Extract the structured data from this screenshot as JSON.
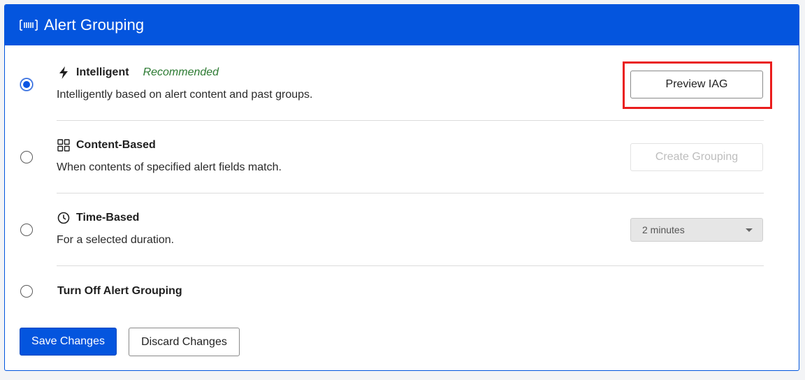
{
  "header": {
    "title": "Alert Grouping",
    "icon": "barcode-icon"
  },
  "options": {
    "intelligent": {
      "title": "Intelligent",
      "badge": "Recommended",
      "description": "Intelligently based on alert content and past groups.",
      "icon": "lightning-icon",
      "selected": true,
      "action_label": "Preview IAG"
    },
    "content_based": {
      "title": "Content-Based",
      "description": "When contents of specified alert fields match.",
      "icon": "grid-icon",
      "selected": false,
      "action_label": "Create Grouping"
    },
    "time_based": {
      "title": "Time-Based",
      "description": "For a selected duration.",
      "icon": "clock-icon",
      "selected": false,
      "select_value": "2 minutes"
    },
    "off": {
      "title": "Turn Off Alert Grouping",
      "selected": false
    }
  },
  "footer": {
    "save_label": "Save Changes",
    "discard_label": "Discard Changes"
  },
  "colors": {
    "accent": "#0455de",
    "recommended": "#2c7a32",
    "highlight": "#ea1d1d"
  }
}
